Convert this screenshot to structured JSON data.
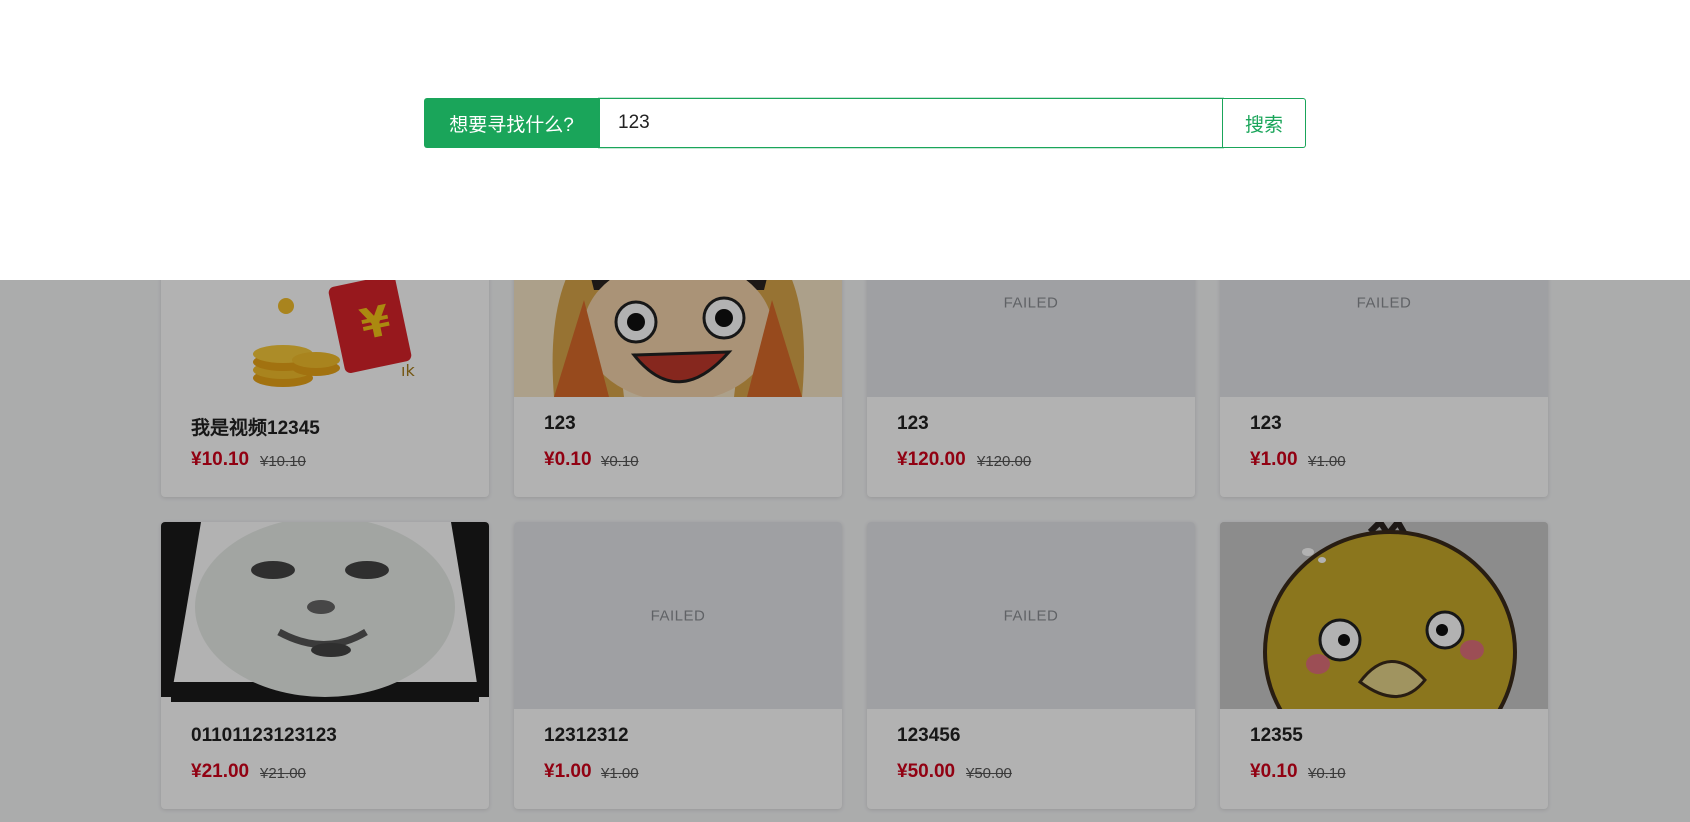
{
  "search": {
    "label": "想要寻找什么?",
    "value": "123",
    "button_label": "搜索"
  },
  "products": [
    {
      "title": "我是视频12345",
      "price": "¥10.10",
      "original_price": "¥10.10",
      "image": "red-envelope-coins"
    },
    {
      "title": "123",
      "price": "¥0.10",
      "original_price": "¥0.10",
      "image": "cartoon-boy-face"
    },
    {
      "title": "123",
      "price": "¥120.00",
      "original_price": "¥120.00",
      "image_status": "FAILED"
    },
    {
      "title": "123",
      "price": "¥1.00",
      "original_price": "¥1.00",
      "image_status": "FAILED"
    },
    {
      "title": "01101123123123",
      "price": "¥21.00",
      "original_price": "¥21.00",
      "image": "panda-meme-face"
    },
    {
      "title": "12312312",
      "price": "¥1.00",
      "original_price": "¥1.00",
      "image_status": "FAILED"
    },
    {
      "title": "123456",
      "price": "¥50.00",
      "original_price": "¥50.00",
      "image_status": "FAILED"
    },
    {
      "title": "12355",
      "price": "¥0.10",
      "original_price": "¥0.10",
      "image": "yellow-duck-cartoon"
    }
  ],
  "colors": {
    "accent": "#1aa55a",
    "price": "#d0021b"
  }
}
